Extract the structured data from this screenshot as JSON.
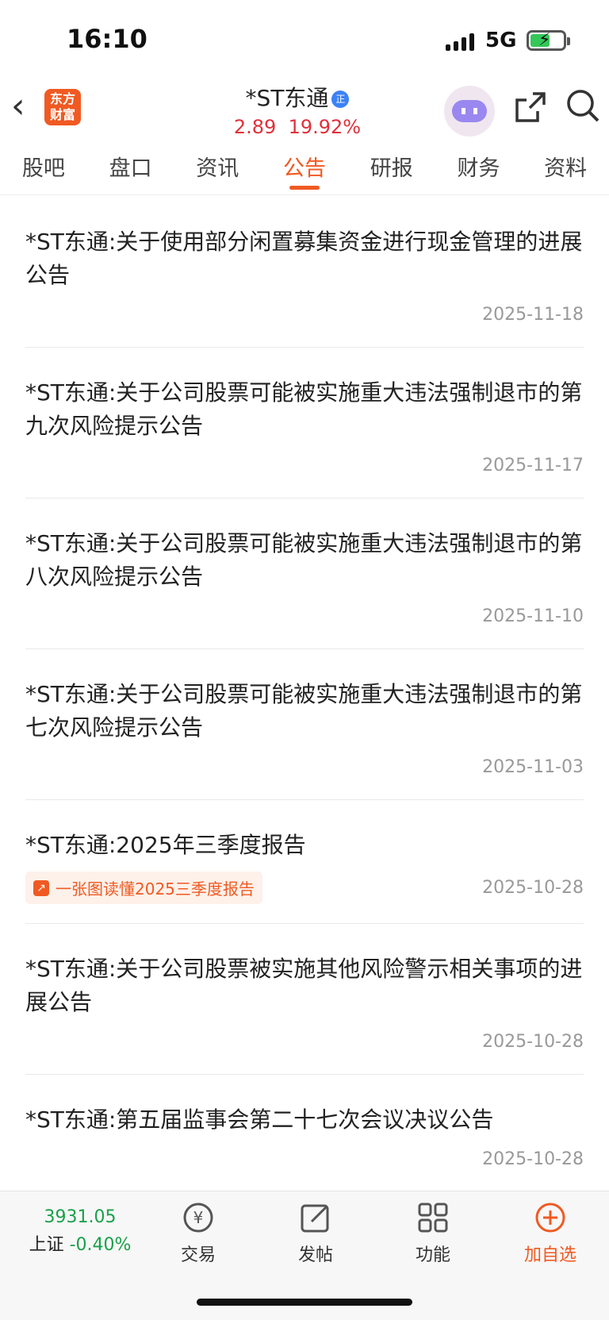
{
  "status": {
    "time": "16:10",
    "network": "5G"
  },
  "header": {
    "logo_line1": "东方",
    "logo_line2": "财富",
    "title": "*ST东通",
    "badge": "正",
    "price": "2.89",
    "change_pct": "19.92%",
    "colors": {
      "accent": "#f05a22",
      "up": "#e0313a",
      "down": "#1aa04a"
    }
  },
  "tabs": [
    "股吧",
    "盘口",
    "资讯",
    "公告",
    "研报",
    "财务",
    "资料"
  ],
  "active_tab": "公告",
  "announcements": [
    {
      "title": "*ST东通:关于使用部分闲置募集资金进行现金管理的进展公告",
      "date": "2025-11-18"
    },
    {
      "title": "*ST东通:关于公司股票可能被实施重大违法强制退市的第九次风险提示公告",
      "date": "2025-11-17"
    },
    {
      "title": "*ST东通:关于公司股票可能被实施重大违法强制退市的第八次风险提示公告",
      "date": "2025-11-10"
    },
    {
      "title": "*ST东通:关于公司股票可能被实施重大违法强制退市的第七次风险提示公告",
      "date": "2025-11-03"
    },
    {
      "title": "*ST东通:2025年三季度报告",
      "date": "2025-10-28",
      "chip": "一张图读懂2025三季度报告"
    },
    {
      "title": "*ST东通:关于公司股票被实施其他风险警示相关事项的进展公告",
      "date": "2025-10-28"
    },
    {
      "title": "*ST东通:第五届监事会第二十七次会议决议公告",
      "date": "2025-10-28"
    }
  ],
  "bottom_nav": {
    "index_value": "3931.05",
    "index_name": "上证",
    "index_change": "-0.40%",
    "trade": "交易",
    "post": "发帖",
    "functions": "功能",
    "add_watch": "加自选"
  }
}
